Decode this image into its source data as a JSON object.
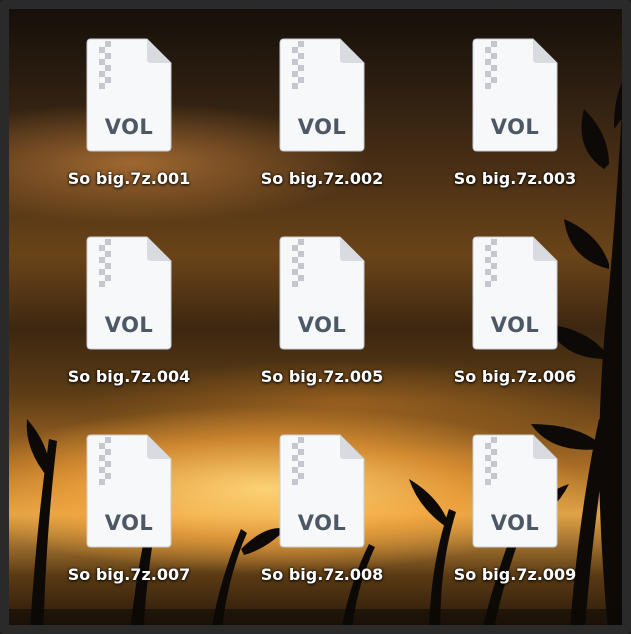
{
  "files": [
    {
      "name": "So big.7z.001",
      "badge": "VOL",
      "icon": "zip-archive-document-icon"
    },
    {
      "name": "So big.7z.002",
      "badge": "VOL",
      "icon": "zip-archive-document-icon"
    },
    {
      "name": "So big.7z.003",
      "badge": "VOL",
      "icon": "zip-archive-document-icon"
    },
    {
      "name": "So big.7z.004",
      "badge": "VOL",
      "icon": "zip-archive-document-icon"
    },
    {
      "name": "So big.7z.005",
      "badge": "VOL",
      "icon": "zip-archive-document-icon"
    },
    {
      "name": "So big.7z.006",
      "badge": "VOL",
      "icon": "zip-archive-document-icon"
    },
    {
      "name": "So big.7z.007",
      "badge": "VOL",
      "icon": "zip-archive-document-icon"
    },
    {
      "name": "So big.7z.008",
      "badge": "VOL",
      "icon": "zip-archive-document-icon"
    },
    {
      "name": "So big.7z.009",
      "badge": "VOL",
      "icon": "zip-archive-document-icon"
    }
  ],
  "colors": {
    "badge_text": "#4d5866",
    "label_text": "#ffffff",
    "page_white": "#f7f8fa",
    "fold_gray": "#d8dbe0"
  }
}
